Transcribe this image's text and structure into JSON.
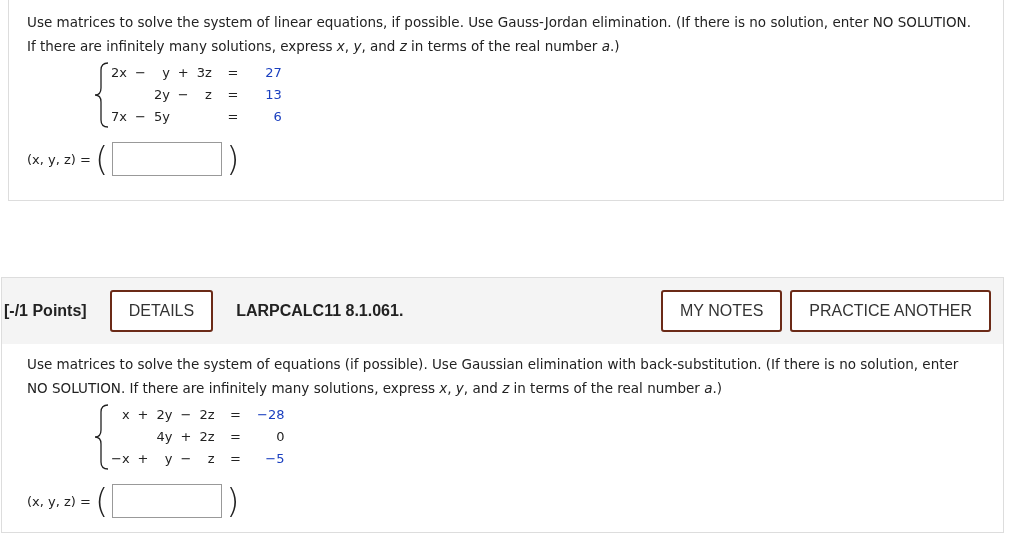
{
  "problems": [
    {
      "prompt": "Use matrices to solve the system of linear equations, if possible. Use Gauss-Jordan elimination. (If there is no solution, enter NO SOLUTION. If there are infinitely many solutions, express *x*, *y*, and *z* in terms of the real number *a*.)",
      "equations": [
        {
          "x_term": "2x",
          "op1": "−",
          "y_term": "y",
          "op2": "+",
          "z_term": "3z",
          "equals": "=",
          "constant": "27",
          "color": "#1a3fbf"
        },
        {
          "y_term": "2y",
          "op2": "−",
          "z_term": "z",
          "equals": "=",
          "constant": "13",
          "color": "#1a3fbf"
        },
        {
          "x_term": "7x",
          "op1": "−",
          "y_term": "5y",
          "equals": "=",
          "constant": "6",
          "color": "#1a3fbf"
        }
      ],
      "answer_label": "(x, y, z) =",
      "open_paren": "(",
      "close_paren": ")"
    },
    {
      "header": {
        "points": "[-/1 Points]",
        "details_button": "DETAILS",
        "problem_id": "LARPCALC11 8.1.061.",
        "buttons": [
          "MY NOTES",
          "PRACTICE ANOTHER"
        ]
      },
      "prompt": "Use matrices to solve the system of equations (if possible). Use Gaussian elimination with back-substitution. (If there is no solution, enter NO SOLUTION. If there are infinitely many solutions, express *x*, *y*, and *z* in terms of the real number *a*.)",
      "equations": [
        {
          "x_term": "x",
          "op1": "+",
          "y_term": "2y",
          "op2": "−",
          "z_term": "2z",
          "equals": "=",
          "constant": "−28",
          "color": "#1a3fbf"
        },
        {
          "y_term": "4y",
          "op2": "+",
          "z_term": "2z",
          "equals": "=",
          "constant": "0",
          "color": "#222222"
        },
        {
          "x_term": "−x",
          "op1": "+",
          "y_term": "y",
          "op2": "−",
          "z_term": "z",
          "equals": "=",
          "constant": "−5",
          "color": "#1a3fbf"
        }
      ],
      "answer_label": "(x, y, z) =",
      "open_paren": "(",
      "close_paren": ")"
    }
  ]
}
